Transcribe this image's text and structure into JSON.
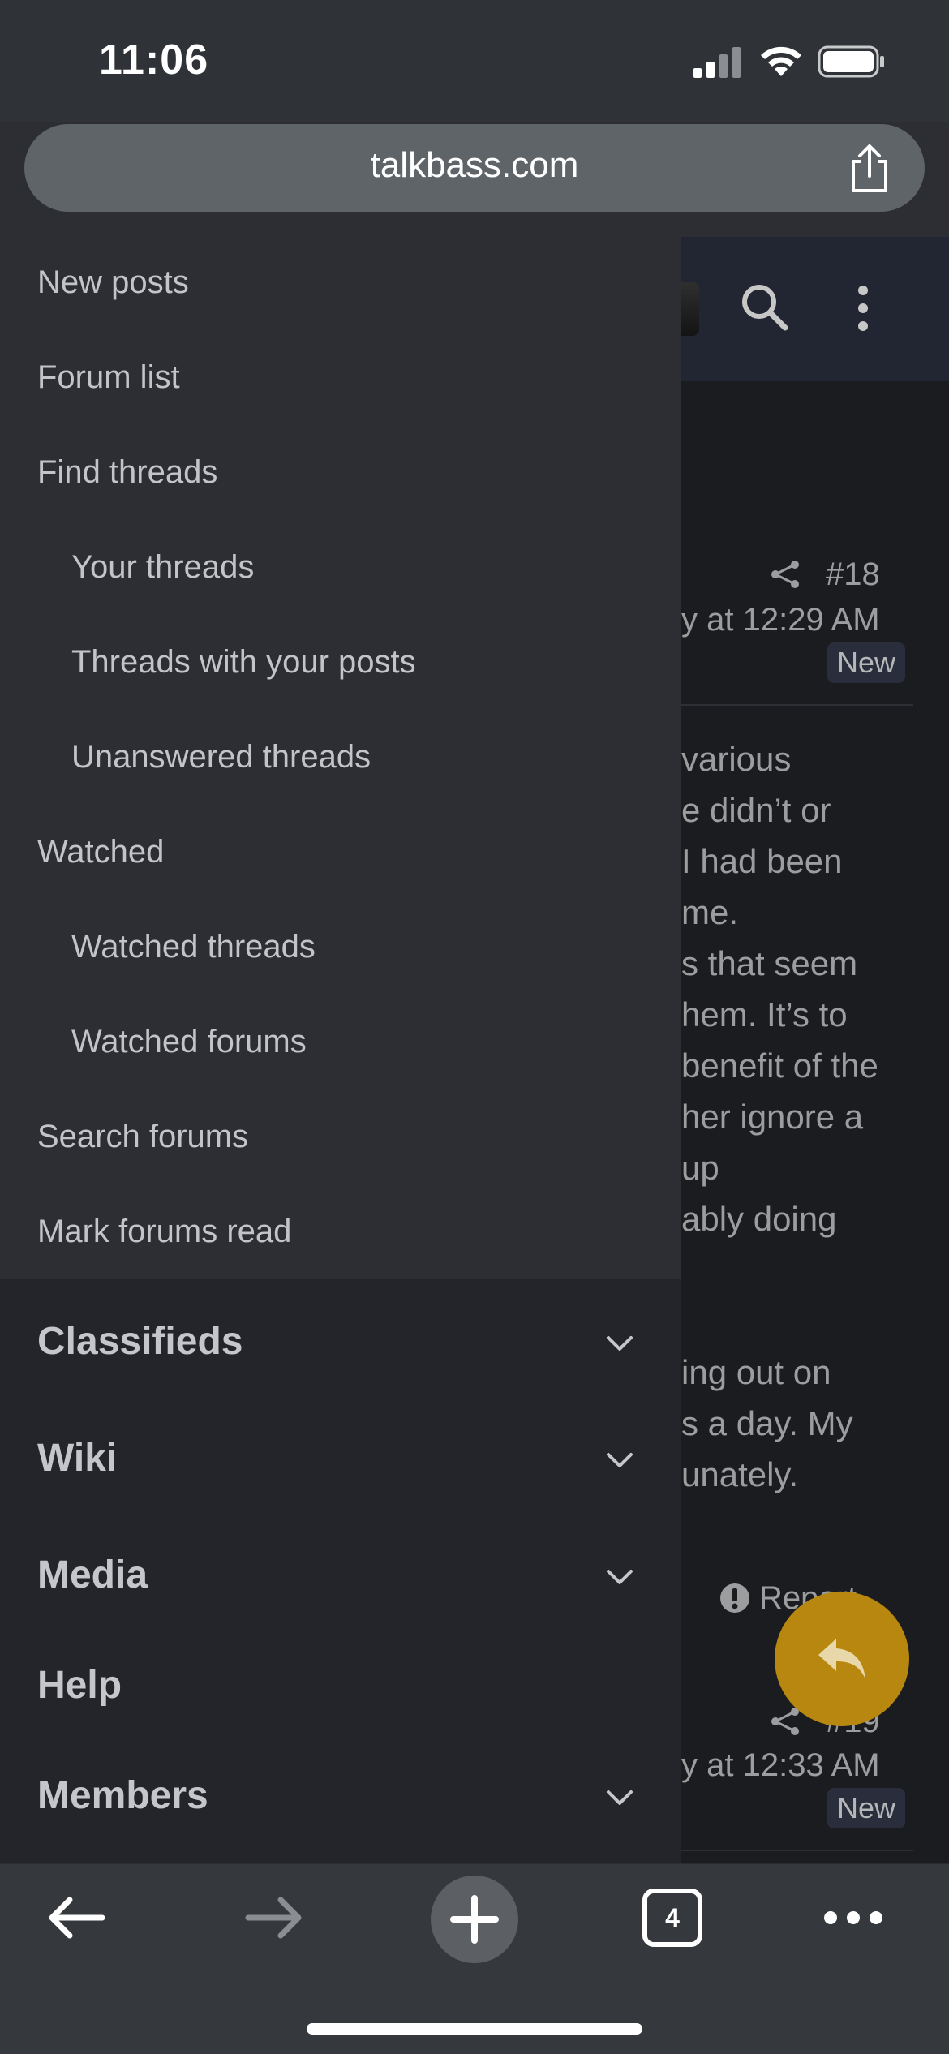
{
  "status_bar": {
    "time": "11:06"
  },
  "browser": {
    "url": "talkbass.com",
    "tab_count": "4"
  },
  "page": {
    "post18": {
      "number": "#18",
      "time_fragment": "y at 12:29 AM",
      "badge": "New",
      "lines": [
        "various",
        "e didn’t or",
        "I had been",
        "me.",
        "s that seem",
        "hem. It’s to",
        "benefit of the",
        "her ignore a",
        " up",
        "ably doing",
        "",
        "ing out on",
        "s a day. My",
        "unately."
      ],
      "report": "Report"
    },
    "post19": {
      "number": "#19",
      "time_fragment": "y at 12:33 AM",
      "badge": "New"
    }
  },
  "drawer": {
    "items": [
      {
        "label": "New posts",
        "level": "top"
      },
      {
        "label": "Forum list",
        "level": "top"
      },
      {
        "label": "Find threads",
        "level": "top"
      },
      {
        "label": "Your threads",
        "level": "sub"
      },
      {
        "label": "Threads with your posts",
        "level": "sub"
      },
      {
        "label": "Unanswered threads",
        "level": "sub"
      },
      {
        "label": "Watched",
        "level": "top"
      },
      {
        "label": "Watched threads",
        "level": "sub"
      },
      {
        "label": "Watched forums",
        "level": "sub"
      },
      {
        "label": "Search forums",
        "level": "top"
      },
      {
        "label": "Mark forums read",
        "level": "top"
      }
    ],
    "sections": [
      {
        "label": "Classifieds",
        "expandable": true
      },
      {
        "label": "Wiki",
        "expandable": true
      },
      {
        "label": "Media",
        "expandable": true
      },
      {
        "label": "Help",
        "expandable": false
      },
      {
        "label": "Members",
        "expandable": true
      }
    ]
  },
  "colors": {
    "fab": "#b8870f",
    "drawer_bg": "#2c2e34",
    "header_bg": "#2c3140"
  },
  "icons": [
    "signal-icon",
    "wifi-icon",
    "battery-icon",
    "share-icon",
    "search-icon",
    "kebab-menu-icon",
    "reply-icon",
    "back-arrow-icon",
    "forward-arrow-icon",
    "plus-icon",
    "tabs-icon",
    "more-icon",
    "chevron-down-icon"
  ]
}
